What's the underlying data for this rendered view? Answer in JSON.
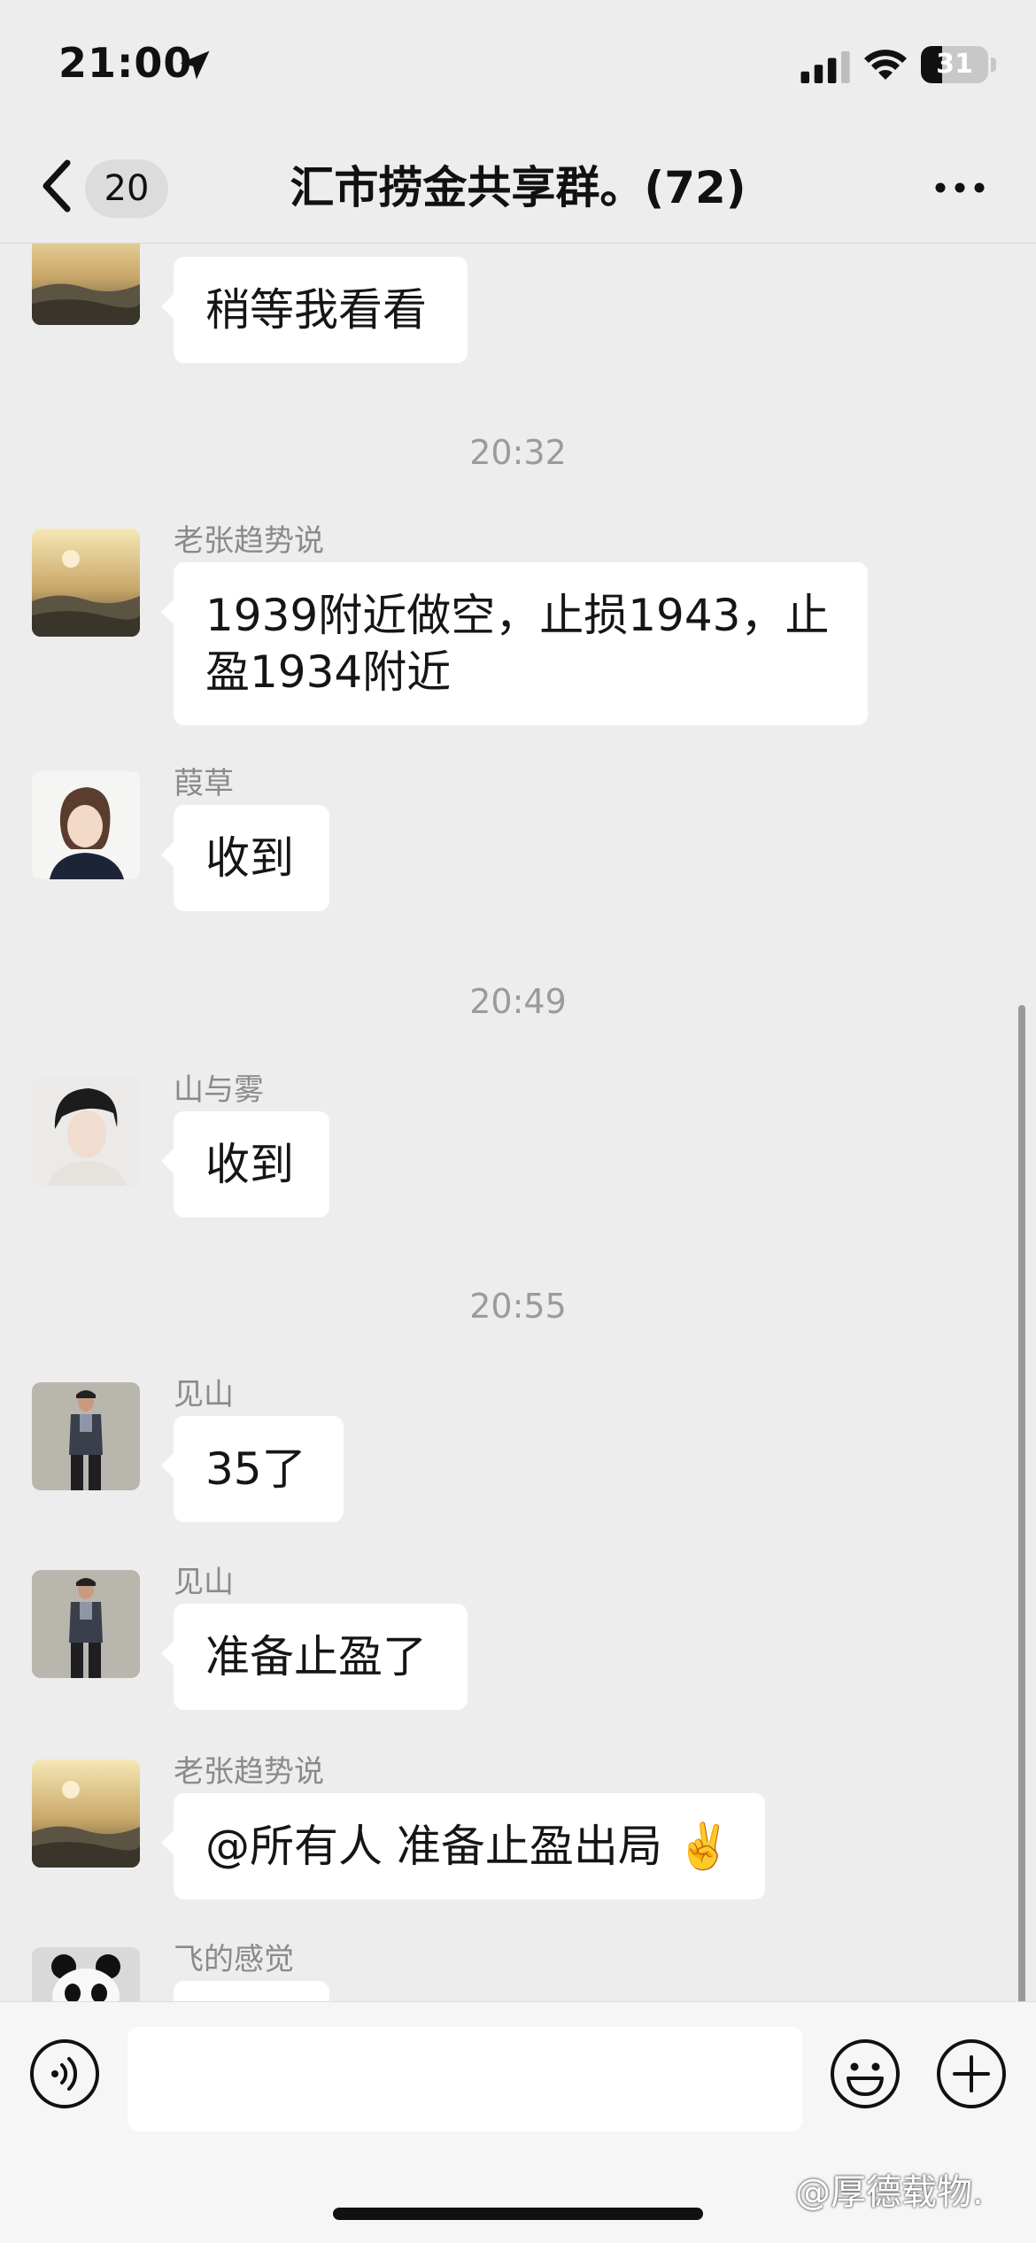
{
  "status_bar": {
    "time": "21:00",
    "battery": "31",
    "battery_level": 0.31
  },
  "header": {
    "unread_count": "20",
    "title": "汇市捞金共享群。(72)"
  },
  "messages": [
    {
      "type": "msg",
      "sender": "",
      "text": "稍等我看看",
      "avatar": "sunset-landscape"
    },
    {
      "type": "time",
      "text": "20:32"
    },
    {
      "type": "msg",
      "sender": "老张趋势说",
      "text": "1939附近做空，止损1943，止盈1934附近",
      "avatar": "sunset-landscape"
    },
    {
      "type": "msg",
      "sender": "葭草",
      "text": "收到",
      "avatar": "girl-portrait"
    },
    {
      "type": "time",
      "text": "20:49"
    },
    {
      "type": "msg",
      "sender": "山与雾",
      "text": "收到",
      "avatar": "boy-portrait"
    },
    {
      "type": "time",
      "text": "20:55"
    },
    {
      "type": "msg",
      "sender": "见山",
      "text": "35了",
      "avatar": "man-in-vest"
    },
    {
      "type": "msg",
      "sender": "见山",
      "text": "准备止盈了",
      "avatar": "man-in-vest"
    },
    {
      "type": "msg",
      "sender": "老张趋势说",
      "text": "@所有人 准备止盈出局 ✌️",
      "avatar": "sunset-landscape"
    },
    {
      "type": "msg",
      "sender": "飞的感觉",
      "text": "",
      "avatar": "panda"
    }
  ],
  "watermark": "@厚德载物.",
  "colors": {
    "background": "#ededed",
    "bubble": "#ffffff",
    "timestamp": "#9b9b9b"
  }
}
